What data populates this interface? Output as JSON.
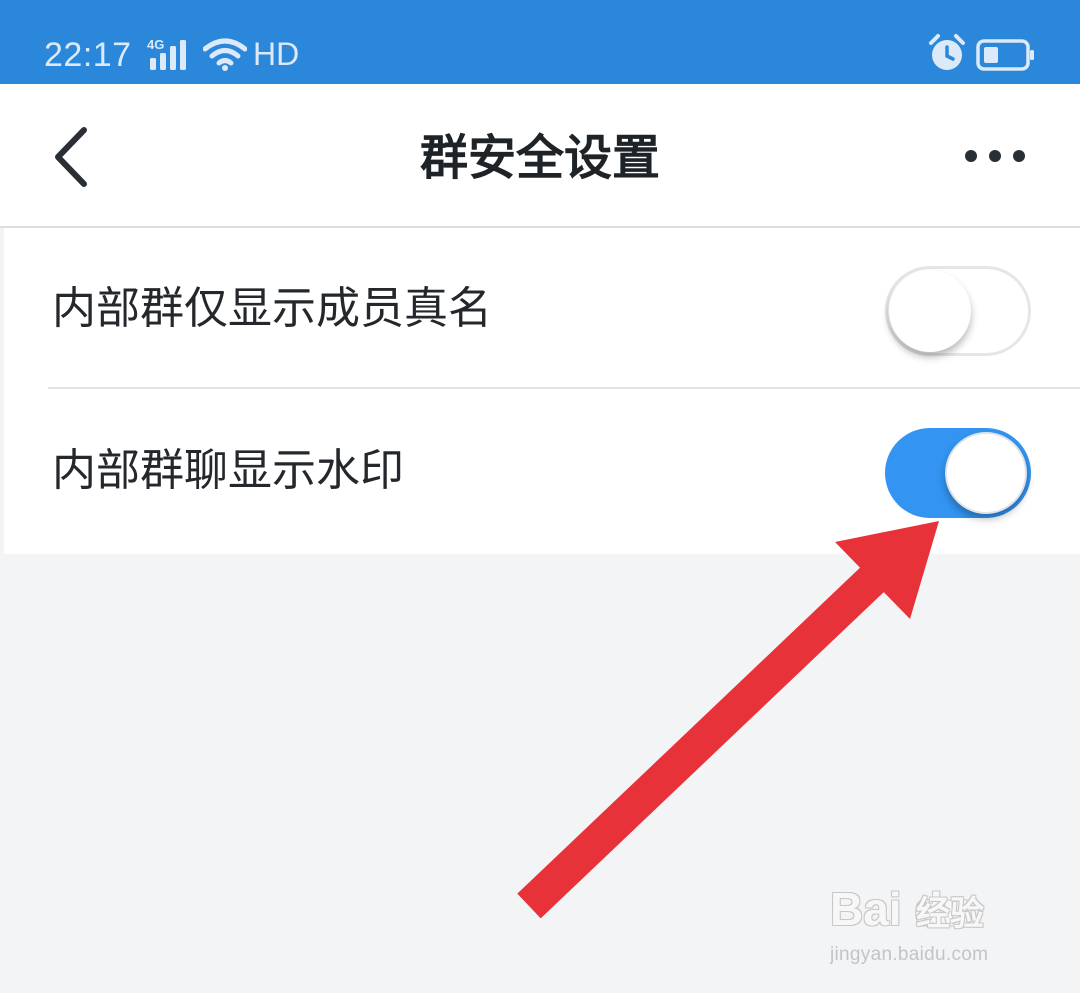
{
  "status_bar": {
    "time": "22:17",
    "network_type": "4G",
    "hd_label": "HD",
    "icons": [
      "signal-icon",
      "wifi-icon",
      "alarm-icon",
      "battery-icon"
    ],
    "background_color": "#2a87da"
  },
  "header": {
    "title": "群安全设置",
    "back_icon": "chevron-left-icon",
    "more_icon": "more-horizontal-icon"
  },
  "settings": [
    {
      "label": "内部群仅显示成员真名",
      "enabled": false
    },
    {
      "label": "内部群聊显示水印",
      "enabled": true
    }
  ],
  "annotation": {
    "type": "red-arrow",
    "points_to": "内部群聊显示水印 toggle",
    "color": "#e8323a"
  },
  "watermark": {
    "brand": "Bai du",
    "product": "经验",
    "url": "jingyan.baidu.com"
  },
  "colors": {
    "toggle_on": "#3394f2",
    "toggle_off": "#ffffff",
    "page_background": "#f3f4f6"
  }
}
